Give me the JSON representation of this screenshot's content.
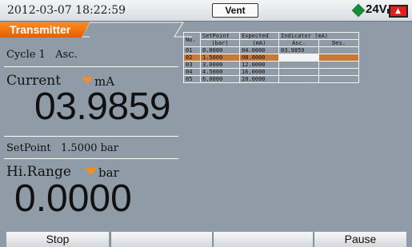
{
  "status_bar": {
    "datetime": "2012-03-07 18:22:59",
    "mode": "Vent",
    "supply": "24V",
    "battery_icon": "battery-low-icon"
  },
  "tab": {
    "label": "Transmitter"
  },
  "left_panel": {
    "cycle_text": "Cycle 1",
    "direction": "Asc.",
    "current_label": "Current",
    "current_unit": "mA",
    "current_value": "03.9859",
    "setpoint_label": "SetPoint",
    "setpoint_value": "1.5000 bar",
    "range_label": "Hi.Range",
    "range_unit": "bar",
    "range_value": "0.0000"
  },
  "table": {
    "headers_row1": [
      "No.",
      "SetPoint",
      "Expected",
      "Indicator (mA)"
    ],
    "headers_row2": [
      "(bar)",
      "(mA)",
      "Asc.",
      "Des."
    ],
    "rows": [
      [
        "01",
        "0.0000",
        "04.0000",
        "03.9859",
        ""
      ],
      [
        "02",
        "1.5000",
        "08.0000",
        "",
        ""
      ],
      [
        "03",
        "3.0000",
        "12.0000",
        "",
        ""
      ],
      [
        "04",
        "4.5000",
        "16.0000",
        "",
        ""
      ],
      [
        "05",
        "6.0000",
        "20.0000",
        "",
        ""
      ]
    ],
    "selected_row": 1
  },
  "softkeys": [
    "Stop",
    "",
    "",
    "Pause"
  ],
  "colors": {
    "accent": "#f07a10",
    "screen": "#8f9ba6",
    "selected_row": "#c67a3a"
  }
}
